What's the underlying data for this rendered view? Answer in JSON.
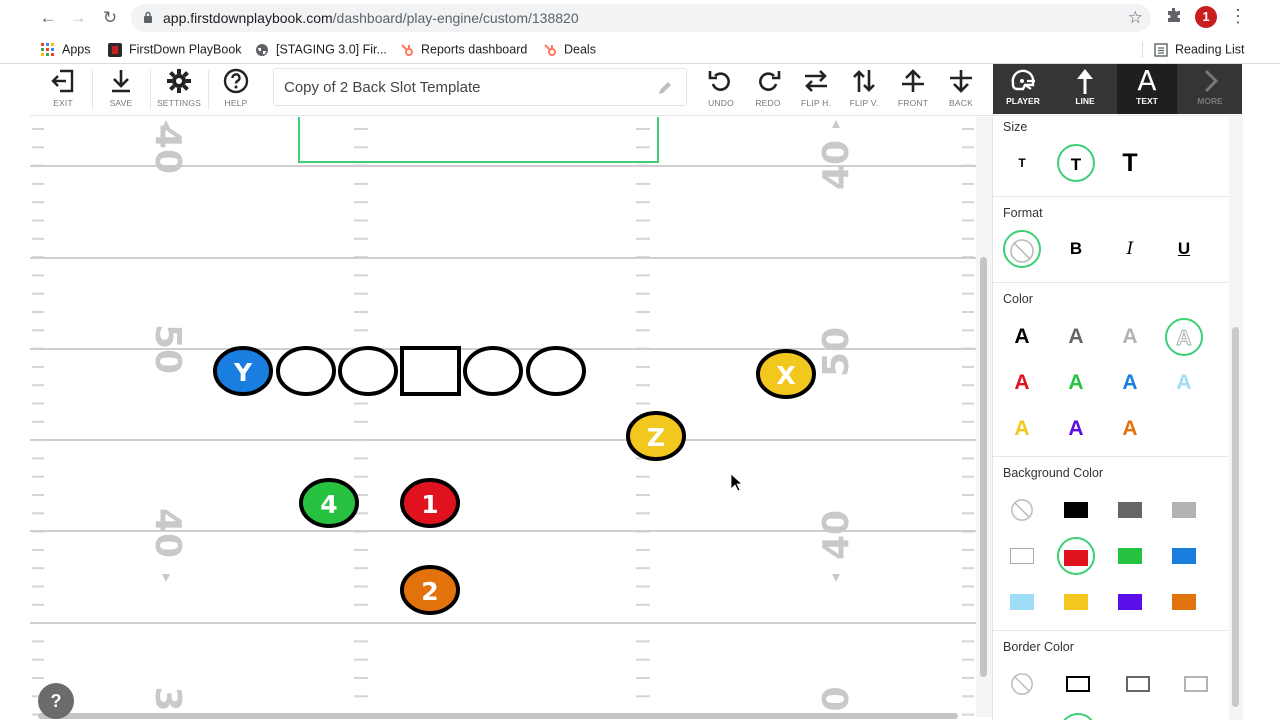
{
  "browser": {
    "url_host": "app.firstdownplaybook.com",
    "url_path": "/dashboard/play-engine/custom/138820",
    "bookmarks": [
      "Apps",
      "FirstDown PlayBook",
      "[STAGING 3.0] Fir...",
      "Reports dashboard",
      "Deals"
    ],
    "reading_list": "Reading List"
  },
  "toolbar": {
    "exit": "EXIT",
    "save": "SAVE",
    "settings": "SETTINGS",
    "help": "HELP",
    "play_title": "Copy of 2 Back Slot Template",
    "undo": "UNDO",
    "redo": "REDO",
    "flip_h": "FLIP H.",
    "flip_v": "FLIP V.",
    "front": "FRONT",
    "back": "BACK"
  },
  "modes": {
    "player": "PLAYER",
    "line": "LINE",
    "text": "TEXT",
    "more": "MORE",
    "active": "text"
  },
  "field": {
    "yard_numbers": [
      "40",
      "50",
      "40",
      "3",
      "0"
    ],
    "players": [
      {
        "label": "Y",
        "color": "#1a7de0"
      },
      {
        "label": "X",
        "color": "#f2c81f"
      },
      {
        "label": "Z",
        "color": "#f2c81f"
      },
      {
        "label": "4",
        "color": "#27c23f"
      },
      {
        "label": "1",
        "color": "#e0121d"
      },
      {
        "label": "2",
        "color": "#e2720c"
      }
    ],
    "linemen": [
      "circle",
      "circle",
      "square",
      "circle",
      "circle"
    ]
  },
  "panel": {
    "size": {
      "title": "Size",
      "options": [
        "T",
        "T",
        "T"
      ],
      "selected": 1
    },
    "format": {
      "title": "Format",
      "options": [
        "none",
        "B",
        "I",
        "U"
      ],
      "selected": 0
    },
    "color": {
      "title": "Color",
      "letter": "A",
      "colors": [
        "#000000",
        "#666666",
        "#b3b3b3",
        "#ffffff",
        "#e0121d",
        "#27c23f",
        "#1a7de0",
        "#9edcf7",
        "#f2c81f",
        "#5a0fe8",
        "#e2720c"
      ],
      "selected": 3
    },
    "background_color": {
      "title": "Background Color",
      "colors": [
        "none",
        "#000000",
        "#666666",
        "#b3b3b3",
        "#ffffff",
        "#e0121d",
        "#27c23f",
        "#1a7de0",
        "#9edcf7",
        "#f2c81f",
        "#5a0fe8",
        "#e2720c"
      ],
      "selected": 5
    },
    "border_color": {
      "title": "Border Color",
      "colors": [
        "none",
        "#000000",
        "#666666",
        "#b3b3b3"
      ]
    }
  },
  "help_button": "?"
}
